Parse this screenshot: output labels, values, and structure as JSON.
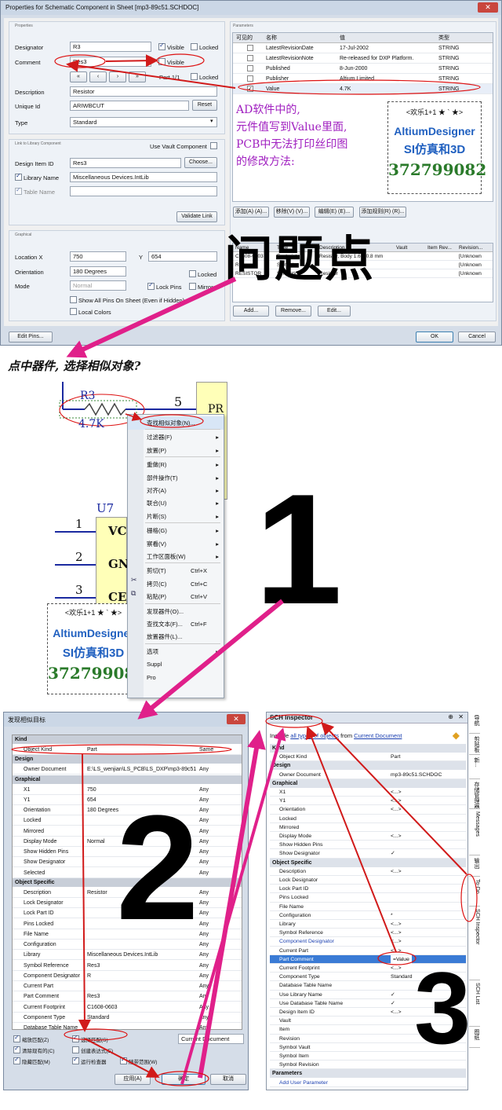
{
  "props_dialog": {
    "title": "Properties for Schematic Component in Sheet [mp3-89c51.SCHDOC]",
    "section_properties": "Properties",
    "section_link": "Link to Library Component",
    "section_graphical": "Graphical",
    "section_parameters": "Parameters",
    "designator_label": "Designator",
    "designator_value": "R3",
    "visible_label": "Visible",
    "locked_label": "Locked",
    "comment_label": "Comment",
    "comment_value": "Res3",
    "part_label": "Part 1/1",
    "description_label": "Description",
    "description_value": "Resistor",
    "unique_id_label": "Unique Id",
    "unique_id_value": "ARIWBCUT",
    "reset_label": "Reset",
    "type_label": "Type",
    "type_value": "Standard",
    "use_vault_label": "Use Vault Component",
    "design_item_id_label": "Design Item ID",
    "design_item_id_value": "Res3",
    "choose_label": "Choose...",
    "library_name_label": "Library Name",
    "library_name_value": "Miscellaneous Devices.IntLib",
    "table_name_label": "Table Name",
    "validate_label": "Validate Link",
    "location_label": "Location  X",
    "location_x": "750",
    "y_label": "Y",
    "location_y": "654",
    "orientation_label": "Orientation",
    "orientation_value": "180 Degrees",
    "mode_label": "Mode",
    "mode_value": "Normal",
    "lock_pins_label": "Lock Pins",
    "mirrored_label": "Mirrored",
    "show_all_pins_label": "Show All Pins On Sheet (Even if Hidden)",
    "local_colors_label": "Local Colors",
    "edit_pins_label": "Edit Pins...",
    "ok_label": "OK",
    "cancel_label": "Cancel",
    "param_headers": [
      "可见的",
      "名称",
      "值",
      "类型"
    ],
    "params": [
      {
        "name": "LatestRevisionDate",
        "value": "17-Jul-2002",
        "type": "STRING",
        "checked": false
      },
      {
        "name": "LatestRevisionNote",
        "value": "Re-released for DXP Platform.",
        "type": "STRING",
        "checked": false
      },
      {
        "name": "Published",
        "value": "8-Jun-2000",
        "type": "STRING",
        "checked": false
      },
      {
        "name": "Publisher",
        "value": "Altium Limited",
        "type": "STRING",
        "checked": false
      },
      {
        "name": "Value",
        "value": "4.7K",
        "type": "STRING",
        "checked": true
      }
    ],
    "param_buttons": [
      "添加(A) (A)...",
      "移除(V) (V)...",
      "编辑(E) (E)...",
      "添加规则(R) (R)..."
    ],
    "model_headers": [
      "Name",
      "Type",
      "Description",
      "Vault",
      "Item Rev...",
      "Revision..."
    ],
    "models": [
      {
        "name": "C1608-0603",
        "type": "Footprint",
        "desc": "Resistor, Body 1.6 x 0.8 mm",
        "rev": "[Unknown"
      },
      {
        "name": "Res",
        "type": "Signal Int",
        "desc": "",
        "rev": "[Unknown"
      },
      {
        "name": "RESISTOR",
        "type": "Simulation",
        "desc": "Resistor",
        "rev": "[Unknown"
      }
    ],
    "model_buttons": [
      "Add...",
      "Remove...",
      "Edit..."
    ]
  },
  "annotation": {
    "line1": "AD软件中的,",
    "line2": "元件值写到Value里面,",
    "line3": "PCB中无法打印丝印图",
    "line4": "的修改方法:",
    "problem": "问题点",
    "step_text": "点中器件,  选择相似对象?",
    "num1": "1",
    "num2": "2",
    "num3": "3"
  },
  "watermark": {
    "top": "<欢乐1+1 ★ ` ★>",
    "brand": "AltiumDesigner",
    "sub": "SI仿真和3D",
    "qq": "372799082"
  },
  "schematic": {
    "ref": "R3",
    "val": "4.7K",
    "pin5": "5",
    "pr": "PR",
    "u7": "U7",
    "pins": [
      "1",
      "2",
      "3"
    ],
    "pin_names": [
      "VC",
      "GN",
      "CE"
    ]
  },
  "context_menu": {
    "items": [
      {
        "label": "查找相似对象(N)...",
        "sc": "",
        "ar": ""
      },
      {
        "label": "过滤器(F)",
        "sc": "",
        "ar": "▸"
      },
      {
        "label": "放置(P)",
        "sc": "",
        "ar": "▸"
      },
      {
        "label": "重做(R)",
        "sc": "",
        "ar": "▸"
      },
      {
        "label": "部件操作(T)",
        "sc": "",
        "ar": "▸"
      },
      {
        "label": "对齐(A)",
        "sc": "",
        "ar": "▸"
      },
      {
        "label": "联合(U)",
        "sc": "",
        "ar": "▸"
      },
      {
        "label": "片断(S)",
        "sc": "",
        "ar": "▸"
      },
      {
        "label": "栅格(G)",
        "sc": "",
        "ar": "▸"
      },
      {
        "label": "察看(V)",
        "sc": "",
        "ar": "▸"
      },
      {
        "label": "工作区面板(W)",
        "sc": "",
        "ar": "▸"
      },
      {
        "label": "剪切(T)",
        "sc": "Ctrl+X",
        "ar": ""
      },
      {
        "label": "拷贝(C)",
        "sc": "Ctrl+C",
        "ar": ""
      },
      {
        "label": "粘贴(P)",
        "sc": "Ctrl+V",
        "ar": ""
      },
      {
        "label": "发现器件(O)...",
        "sc": "",
        "ar": ""
      },
      {
        "label": "查找文本(F)...",
        "sc": "Ctrl+F",
        "ar": ""
      },
      {
        "label": "放置器件(L)...",
        "sc": "",
        "ar": ""
      },
      {
        "label": "选项",
        "sc": "",
        "ar": "▸"
      },
      {
        "label": "Suppl",
        "sc": "",
        "ar": ""
      },
      {
        "label": "Pro",
        "sc": "",
        "ar": ""
      }
    ]
  },
  "find_dialog": {
    "title": "发现相似目标",
    "rows": [
      {
        "g": "Kind"
      },
      {
        "k": "Object Kind",
        "v": "Part",
        "m": "Same"
      },
      {
        "g": "Design"
      },
      {
        "k": "Owner Document",
        "v": "E:\\LS_wenjian\\LS_PCB\\LS_DXP\\mp3-89c51",
        "m": "Any"
      },
      {
        "g": "Graphical"
      },
      {
        "k": "X1",
        "v": "750",
        "m": "Any"
      },
      {
        "k": "Y1",
        "v": "654",
        "m": "Any"
      },
      {
        "k": "Orientation",
        "v": "180 Degrees",
        "m": "Any"
      },
      {
        "k": "Locked",
        "v": "",
        "m": "Any"
      },
      {
        "k": "Mirrored",
        "v": "",
        "m": "Any"
      },
      {
        "k": "Display Mode",
        "v": "Normal",
        "m": "Any"
      },
      {
        "k": "Show Hidden Pins",
        "v": "",
        "m": "Any"
      },
      {
        "k": "Show Designator",
        "v": "",
        "m": "Any"
      },
      {
        "k": "Selected",
        "v": "",
        "m": "Any"
      },
      {
        "g": "Object Specific"
      },
      {
        "k": "Description",
        "v": "Resistor",
        "m": "Any"
      },
      {
        "k": "Lock Designator",
        "v": "",
        "m": "Any"
      },
      {
        "k": "Lock Part ID",
        "v": "",
        "m": "Any"
      },
      {
        "k": "Pins Locked",
        "v": "",
        "m": "Any"
      },
      {
        "k": "File Name",
        "v": "",
        "m": "Any"
      },
      {
        "k": "Configuration",
        "v": "",
        "m": "Any"
      },
      {
        "k": "Library",
        "v": "Miscellaneous Devices.IntLib",
        "m": "Any"
      },
      {
        "k": "Symbol Reference",
        "v": "Res3",
        "m": "Any"
      },
      {
        "k": "Component Designator",
        "v": "R",
        "m": "Any"
      },
      {
        "k": "Current Part",
        "v": "",
        "m": "Any"
      },
      {
        "k": "Part Comment",
        "v": "Res3",
        "m": "Any"
      },
      {
        "k": "Current Footprint",
        "v": "C1608-0603",
        "m": "Any"
      },
      {
        "k": "Component Type",
        "v": "Standard",
        "m": "Any"
      },
      {
        "k": "Database Table Name",
        "v": "",
        "m": "Any"
      }
    ],
    "opt_zoom": "缩放匹配(Z)",
    "opt_select": "选择匹配(S)",
    "opt_clear": "清除现有的(C)",
    "opt_create": "创建表达式(E)",
    "opt_mask": "隐藏匹配(M)",
    "opt_run": "运行检查器",
    "opt_whole": "随带范围(W)",
    "scope": "Current Document",
    "apply": "应用(A)",
    "ok": "确定",
    "cancel": "取消"
  },
  "inspector": {
    "title": "SCH Inspector",
    "include_text": "Include",
    "include_link": "all types of objects",
    "from_text": "from",
    "doc_link": "Current Document",
    "rows": [
      {
        "g": "Kind"
      },
      {
        "k": "Object Kind",
        "v": "Part"
      },
      {
        "g": "Design"
      },
      {
        "k": "Owner Document",
        "v": "mp3-89c51.SCHDOC"
      },
      {
        "g": "Graphical"
      },
      {
        "k": "X1",
        "v": "<...>"
      },
      {
        "k": "Y1",
        "v": "<...>"
      },
      {
        "k": "Orientation",
        "v": "<...>"
      },
      {
        "k": "Locked",
        "v": ""
      },
      {
        "k": "Mirrored",
        "v": ""
      },
      {
        "k": "Display Mode",
        "v": "<...>"
      },
      {
        "k": "Show Hidden Pins",
        "v": ""
      },
      {
        "k": "Show Designator",
        "v": "✓"
      },
      {
        "g": "Object Specific"
      },
      {
        "k": "Description",
        "v": "<...>"
      },
      {
        "k": "Lock Designator",
        "v": ""
      },
      {
        "k": "Lock Part ID",
        "v": ""
      },
      {
        "k": "Pins Locked",
        "v": ""
      },
      {
        "k": "File Name",
        "v": ""
      },
      {
        "k": "Configuration",
        "v": "*"
      },
      {
        "k": "Library",
        "v": "<...>"
      },
      {
        "k": "Symbol Reference",
        "v": "<...>"
      },
      {
        "k": "Component Designator",
        "v": "<...>"
      },
      {
        "k": "Current Part",
        "v": "<...>"
      },
      {
        "k": "Part Comment",
        "v": "=Value"
      },
      {
        "k": "Current Footprint",
        "v": "<...>"
      },
      {
        "k": "Component Type",
        "v": "Standard"
      },
      {
        "k": "Database Table Name",
        "v": ""
      },
      {
        "k": "Use Library Name",
        "v": "✓"
      },
      {
        "k": "Use Database Table Name",
        "v": "✓"
      },
      {
        "k": "Design Item ID",
        "v": "<...>"
      },
      {
        "k": "Vault",
        "v": ""
      },
      {
        "k": "Item",
        "v": ""
      },
      {
        "k": "Revision",
        "v": ""
      },
      {
        "k": "Symbol Vault",
        "v": ""
      },
      {
        "k": "Symbol Item",
        "v": ""
      },
      {
        "k": "Symbol Revision",
        "v": ""
      },
      {
        "g": "Parameters"
      },
      {
        "k": "Add User Parameter",
        "v": ""
      }
    ],
    "side_tabs": [
      "导航",
      "剪贴板",
      "新...",
      "存储管理器",
      "Messages",
      "输出",
      "To-Do",
      "SCH Inspector",
      "SCH List",
      "图纸"
    ]
  },
  "colors": {
    "accent_red": "#d11a1a",
    "arrow_magenta": "#e0208a",
    "annotation_purple": "#a020c0",
    "dialog_bg": "#f0f0f0"
  }
}
